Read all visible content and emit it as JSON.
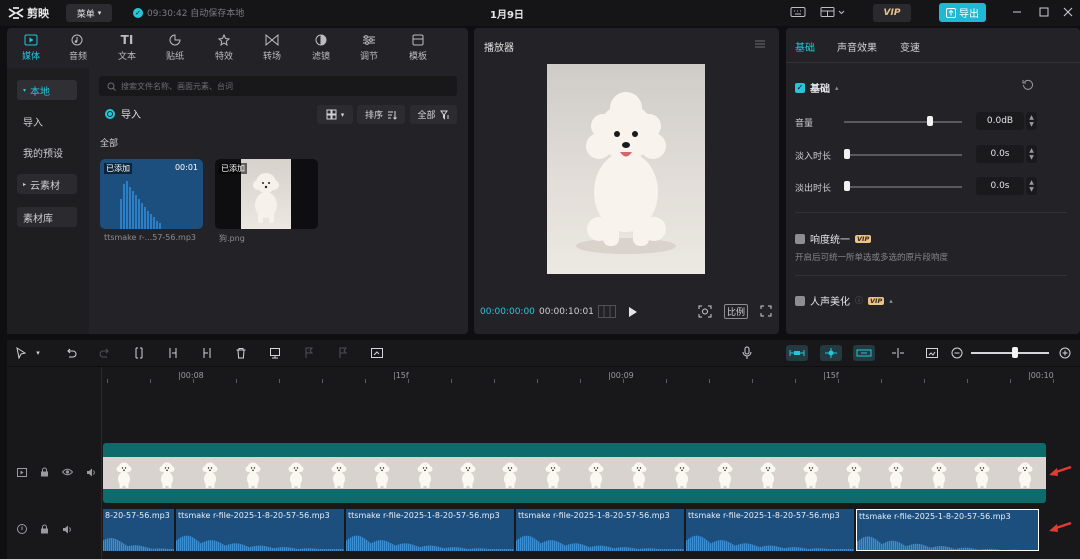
{
  "app": {
    "logo_text": "剪映",
    "menu_label": "菜单",
    "save_status": "09:30:42 自动保存本地",
    "doc_title": "1月9日",
    "vip_label": "VIP",
    "export_label": "导出"
  },
  "media_tabs": [
    {
      "label": "媒体",
      "icon": "media-icon",
      "active": true
    },
    {
      "label": "音频",
      "icon": "audio-icon"
    },
    {
      "label": "文本",
      "icon": "text-icon"
    },
    {
      "label": "贴纸",
      "icon": "sticker-icon"
    },
    {
      "label": "特效",
      "icon": "effects-icon"
    },
    {
      "label": "转场",
      "icon": "transition-icon"
    },
    {
      "label": "滤镜",
      "icon": "filter-icon"
    },
    {
      "label": "调节",
      "icon": "adjust-icon"
    },
    {
      "label": "模板",
      "icon": "template-icon"
    }
  ],
  "sidebar": {
    "items": [
      "本地",
      "导入",
      "我的预设",
      "云素材",
      "素材库"
    ]
  },
  "media_browser": {
    "search_placeholder": "搜索文件名称、画面元素、台词",
    "import_label": "导入",
    "sort_label": "排序",
    "filter_label": "全部",
    "all_label": "全部",
    "cards": [
      {
        "badge": "已添加",
        "duration": "00:01",
        "name": "ttsmake r-...57-56.mp3",
        "kind": "audio"
      },
      {
        "badge": "已添加",
        "duration": "",
        "name": "狗.png",
        "kind": "image"
      }
    ]
  },
  "player": {
    "title": "播放器",
    "current_time": "00:00:00:00",
    "total_time": "00:00:10:01",
    "ratio_label": "比例"
  },
  "properties": {
    "tabs": [
      "基础",
      "声音效果",
      "变速"
    ],
    "basic_title": "基础",
    "rows": [
      {
        "label": "音量",
        "value": "0.0dB",
        "level": 0.74
      },
      {
        "label": "淡入时长",
        "value": "0.0s",
        "level": 0.0
      },
      {
        "label": "淡出时长",
        "value": "0.0s",
        "level": 0.0
      }
    ],
    "loudness_title": "响度统一",
    "loudness_desc": "开启后可统一所单选或多选的原片段响度",
    "voice_title": "人声美化",
    "vip_tag": "VIP"
  },
  "timeline": {
    "ticks": [
      "|00:08",
      "|15f",
      "|00:09",
      "|15f",
      "|00:10"
    ],
    "audio_clips": [
      "8-20-57-56.mp3",
      "ttsmake r-file-2025-1-8-20-57-56.mp3",
      "ttsmake r-file-2025-1-8-20-57-56.mp3",
      "ttsmake r-file-2025-1-8-20-57-56.mp3",
      "ttsmake r-file-2025-1-8-20-57-56.mp3",
      "ttsmake r-file-2025-1-8-20-57-56.mp3"
    ]
  },
  "colors": {
    "accent": "#26c6da",
    "video_clip": "#0d6b6b",
    "audio_clip": "#1d4f7e",
    "annotation_arrow": "#e53935"
  }
}
